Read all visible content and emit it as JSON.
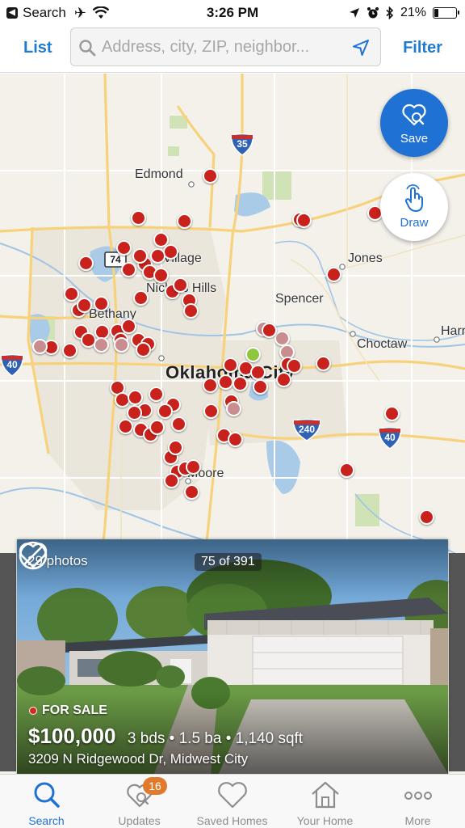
{
  "status_bar": {
    "back_app": "Search",
    "time": "3:26 PM",
    "battery": "21%",
    "battery_level": 0.21
  },
  "header": {
    "list_label": "List",
    "filter_label": "Filter",
    "search_placeholder": "Address, city, ZIP, neighbor..."
  },
  "map": {
    "places": [
      "Edmond",
      "Jones",
      "Spencer",
      "Choctaw",
      "Harr",
      "Oklahoma City",
      "Village",
      "Nichols Hills",
      "Bethany",
      "Moore"
    ],
    "highways": [
      "35",
      "74",
      "40",
      "240",
      "40"
    ],
    "save_label": "Save",
    "draw_label": "Draw"
  },
  "listing": {
    "photos_label": "29 photos",
    "index_label": "75 of 391",
    "status_label": "FOR SALE",
    "price": "$100,000",
    "facts": "3 bds • 1.5 ba • 1,140 sqft",
    "address": "3209 N Ridgewood Dr, Midwest City"
  },
  "tabs": [
    {
      "label": "Search",
      "icon": "search-icon",
      "active": true
    },
    {
      "label": "Updates",
      "icon": "updates-icon",
      "badge": "16"
    },
    {
      "label": "Saved Homes",
      "icon": "heart-icon"
    },
    {
      "label": "Your Home",
      "icon": "house-icon"
    },
    {
      "label": "More",
      "icon": "more-icon"
    }
  ],
  "colors": {
    "accent": "#1f72d3",
    "pin_red": "#c9211b",
    "pin_visited": "#c98d8f",
    "pin_selected": "#8ec63f",
    "badge": "#e07a2c"
  }
}
